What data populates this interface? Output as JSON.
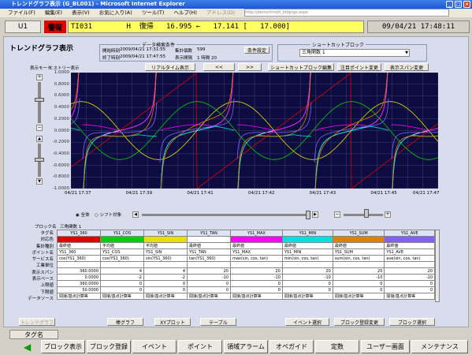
{
  "window": {
    "title": "トレンドグラフ表示 (G_BL001) - Microsoft Internet Explorer"
  },
  "menu": [
    "ファイル(F)",
    "編集(E)",
    "表示(V)",
    "お気に入り(A)",
    "ツール(T)",
    "ヘルプ(H)"
  ],
  "address": {
    "label": "アドレス(D)",
    "value": "http://demo/trnd/t_bldprgs.aspx"
  },
  "status": {
    "unit": "U1",
    "alarm": "警報",
    "message": "TI031        H  復帰   16.995 ←   17.141 [   17.000]",
    "clock": "09/04/21 17:48:11"
  },
  "page": {
    "title": "トレンドグラフ表示"
  },
  "search": {
    "group_label": "データ検索条件",
    "start_label": "開始時刻",
    "start_value": "2009/04/21 17:31:55",
    "end_label": "終了時刻",
    "end_value": "2009/04/21 17:47:55",
    "count_label": "集計個数",
    "count_value": "599",
    "interval_label": "表示間隔",
    "interval_value": "1 時間 20",
    "setting_button": "条件設定"
  },
  "shortcut": {
    "group_label": "ショートカットブロック",
    "selected": "三角関数 1"
  },
  "mode": {
    "label": "表示モード",
    "value": "ヒストリー表示"
  },
  "toolbar": {
    "realtime": "リアルタイム表示",
    "prev": "<<",
    "next": ">>",
    "shortcut_edit": "ショートカットブロック編集",
    "point_change": "注目ポイント変更",
    "span_change": "表示スパン変更"
  },
  "yaxis": [
    "1.0000",
    "0.8000",
    "0.6000",
    "0.4000",
    "0.2000",
    "0.0000",
    "-0.2000",
    "-0.4000",
    "-0.6000",
    "-0.8000",
    "-1.0000"
  ],
  "xaxis": [
    "04/21 17:37",
    "04/21 17:39",
    "04/21 17:41",
    "04/21 17:42",
    "04/21 17:43",
    "04/21 17:45",
    "04/21 17:47"
  ],
  "radio": {
    "all": "全体",
    "shift": "シフト対象"
  },
  "block": {
    "label": "ブロック名",
    "value": "三角関数 1"
  },
  "rowlabels": [
    "タグ名",
    "対応色",
    "集計種別",
    "ポイント名",
    "サービス名",
    "工業単位",
    "表示スパン",
    "表示ベース",
    "上限値",
    "下限値",
    "データソース"
  ],
  "columns": [
    {
      "tag": "YS1_360",
      "color": "#e00000",
      "kind": "最終値",
      "point": "YS1_360",
      "service": "cos(YS1_360)",
      "span": "360.0000",
      "base": "0.0000",
      "hi": "360.0000",
      "lo": "50.0000",
      "src": "間接/基点計算等"
    },
    {
      "tag": "YS1_COS",
      "color": "#00d000",
      "kind": "平均値",
      "point": "YS1_COS",
      "service": "cos(YS1_360)",
      "span": "4",
      "base": "-2",
      "hi": "0",
      "lo": "0",
      "src": "間接/基点計算等"
    },
    {
      "tag": "YS1_SIN",
      "color": "#e8e000",
      "kind": "平均値",
      "point": "YS1_SIN",
      "service": "sin(YS1_360)",
      "span": "4",
      "base": "-2",
      "hi": "0",
      "lo": "0",
      "src": "間接/基点計算等"
    },
    {
      "tag": "YS1_TAN",
      "color": "#ffffff",
      "kind": "最終値",
      "point": "YS1_TAN",
      "service": "tan(YS1_360)",
      "span": "20",
      "base": "-10",
      "hi": "0",
      "lo": "0",
      "src": "間接/基点計算等"
    },
    {
      "tag": "YS1_MAX",
      "color": "#ff00ff",
      "kind": "最終値",
      "point": "YS1_MAX",
      "service": "max(sin, cos, tan)",
      "span": "20",
      "base": "-10",
      "hi": "0",
      "lo": "0",
      "src": "間接/基点計算等"
    },
    {
      "tag": "YS1_MIN",
      "color": "#00e0e0",
      "kind": "最終値",
      "point": "YS1_MIN",
      "service": "min(sin, cos, tan)",
      "span": "20",
      "base": "-10",
      "hi": "0",
      "lo": "0",
      "src": "間接/基点計算等"
    },
    {
      "tag": "YS1_SUM",
      "color": "#e08000",
      "kind": "最終値",
      "point": "YS1_SUM",
      "service": "sum(sin, cos, tan)",
      "span": "20",
      "base": "-10",
      "hi": "0",
      "lo": "0",
      "src": "間接/基点計算等"
    },
    {
      "tag": "YS1_AVE",
      "color": "#8060ff",
      "kind": "最終値",
      "point": "YS1_AVE",
      "service": "ave(sin, cos, tan)",
      "span": "20",
      "base": "-10",
      "hi": "0",
      "lo": "0",
      "src": "間接/基点計算等"
    }
  ],
  "lower_buttons": {
    "trend": "トレンドグラフ",
    "bar": "棒グラフ",
    "xy": "XYプロット",
    "table": "テーブル",
    "event": "イベント選択",
    "block_reg": "ブロック登録変更",
    "block_sel": "ブロック選択"
  },
  "bottom": {
    "tagname": "タグ名",
    "keys": [
      "ブロック表示",
      "ブロック登録",
      "イベント",
      "ポイント",
      "領域アラーム",
      "オペガイド",
      "定数",
      "ユーザー画面",
      "メンテナンス"
    ]
  }
}
